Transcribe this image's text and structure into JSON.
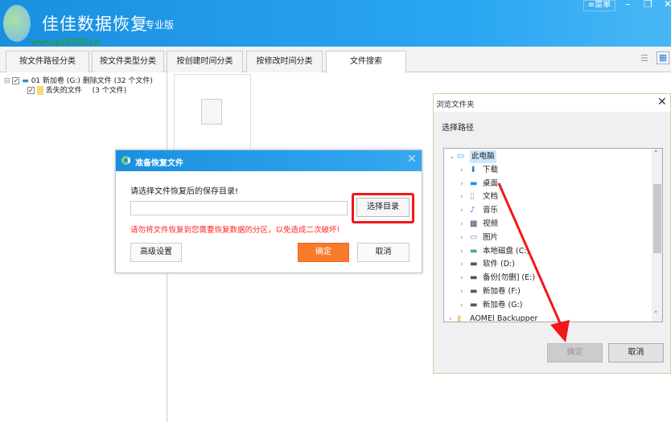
{
  "app": {
    "title": "佳佳数据恢复",
    "edition": "专业版",
    "watermark": "www.pc0359.cn",
    "menu_label": "≡菜单",
    "minimize": "–",
    "restore": "❐",
    "close": "✕"
  },
  "tabs": [
    {
      "label": "按文件路径分类"
    },
    {
      "label": "按文件类型分类"
    },
    {
      "label": "按创建时间分类"
    },
    {
      "label": "按修改时间分类"
    },
    {
      "label": "文件搜索",
      "active": true
    }
  ],
  "view_icons": {
    "list": "☰",
    "grid": "▦"
  },
  "tree": {
    "root": "01 新加卷 (G:) 删除文件 (32 个文件)",
    "child": "丢失的文件",
    "child_count": "(3 个文件)"
  },
  "restore_dialog": {
    "title": "准备恢复文件",
    "close": "✕",
    "prompt": "请选择文件恢复后的保存目录!",
    "path_value": "",
    "choose_button": "选择目录",
    "warning": "请勿将文件恢复到您需要恢复数据的分区，以免造成二次破坏!",
    "advanced_button": "高级设置",
    "ok_button": "确定",
    "cancel_button": "取消"
  },
  "browse_dialog": {
    "title": "浏览文件夹",
    "close": "✕",
    "label": "选择路径",
    "nodes": [
      {
        "label": "此电脑",
        "icon": "pc",
        "chev": "⌄",
        "level": 0,
        "selected": true
      },
      {
        "label": "下载",
        "icon": "download",
        "chev": "›",
        "level": 1
      },
      {
        "label": "桌面",
        "icon": "desktop",
        "chev": "›",
        "level": 1
      },
      {
        "label": "文档",
        "icon": "document",
        "chev": "›",
        "level": 1
      },
      {
        "label": "音乐",
        "icon": "music",
        "chev": "›",
        "level": 1
      },
      {
        "label": "视频",
        "icon": "video",
        "chev": "›",
        "level": 1
      },
      {
        "label": "图片",
        "icon": "picture",
        "chev": "›",
        "level": 1
      },
      {
        "label": "本地磁盘 (C:)",
        "icon": "system-drive",
        "chev": "›",
        "level": 1
      },
      {
        "label": "软件 (D:)",
        "icon": "drive",
        "chev": "›",
        "level": 1
      },
      {
        "label": "备份[勿删] (E:)",
        "icon": "drive",
        "chev": "›",
        "level": 1
      },
      {
        "label": "新加卷 (F:)",
        "icon": "drive",
        "chev": "›",
        "level": 1
      },
      {
        "label": "新加卷 (G:)",
        "icon": "drive",
        "chev": "›",
        "level": 1
      },
      {
        "label": "AOMEI Backupper",
        "icon": "folder",
        "chev": "›",
        "level": 0
      }
    ],
    "ok_button": "确定",
    "cancel_button": "取消"
  },
  "colors": {
    "accent": "#1a8fe0",
    "ok_orange": "#f87a2a",
    "warning": "#ff2222",
    "annotation": "#f01818"
  }
}
